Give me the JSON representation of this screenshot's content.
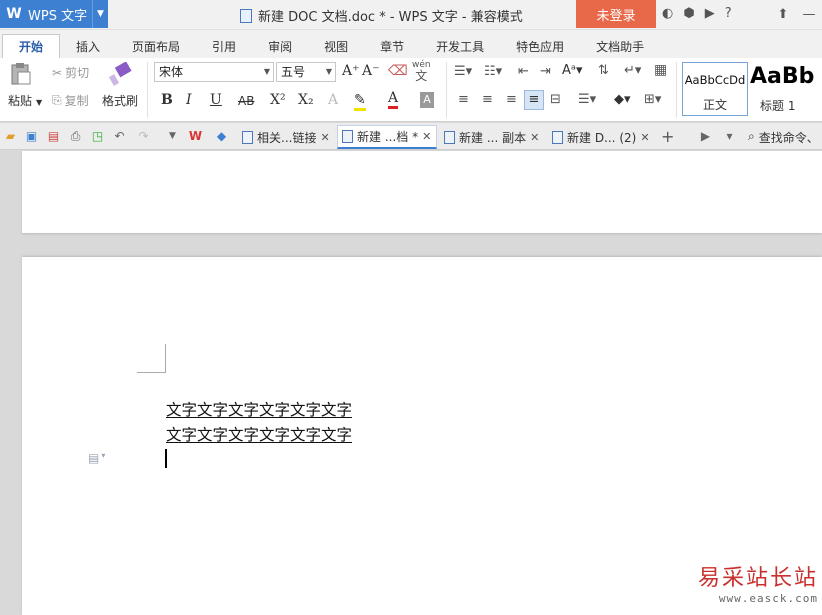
{
  "titlebar": {
    "app_name": "WPS 文字",
    "app_logo": "W",
    "doc_title": "新建 DOC 文档.doc * - WPS 文字 - 兼容模式",
    "login_label": "未登录",
    "help_label": "?"
  },
  "tabs": [
    "开始",
    "插入",
    "页面布局",
    "引用",
    "审阅",
    "视图",
    "章节",
    "开发工具",
    "特色应用",
    "文档助手"
  ],
  "ribbon": {
    "paste": "粘贴",
    "cut": "剪切",
    "copy": "复制",
    "format_painter": "格式刷",
    "font_name": "宋体",
    "font_size": "五号",
    "bold": "B",
    "italic": "I",
    "underline": "U",
    "strike": "AB",
    "superscript": "X²",
    "subscript": "X₂",
    "wen": "wén",
    "wen_char": "文",
    "style_normal_sample": "AaBbCcDd",
    "style_normal_name": "正文",
    "style_h1_sample": "AaBb",
    "style_h1_name": "标题 1"
  },
  "doc_tabs": [
    {
      "label": "相关...链接",
      "active": false
    },
    {
      "label": "新建 ...档 *",
      "active": true
    },
    {
      "label": "新建 ... 副本",
      "active": false
    },
    {
      "label": "新建 D... (2)",
      "active": false
    }
  ],
  "search_cmd": "查找命令、",
  "document": {
    "lines": [
      "文字文字文字文字文字文字",
      "文字文字文字文字文字文字"
    ]
  },
  "watermark": {
    "cn": "易采站长站",
    "url": "www.easck.com"
  },
  "colors": {
    "accent": "#3d7fd1",
    "login": "#e8694a",
    "watermark": "#c8312e"
  }
}
